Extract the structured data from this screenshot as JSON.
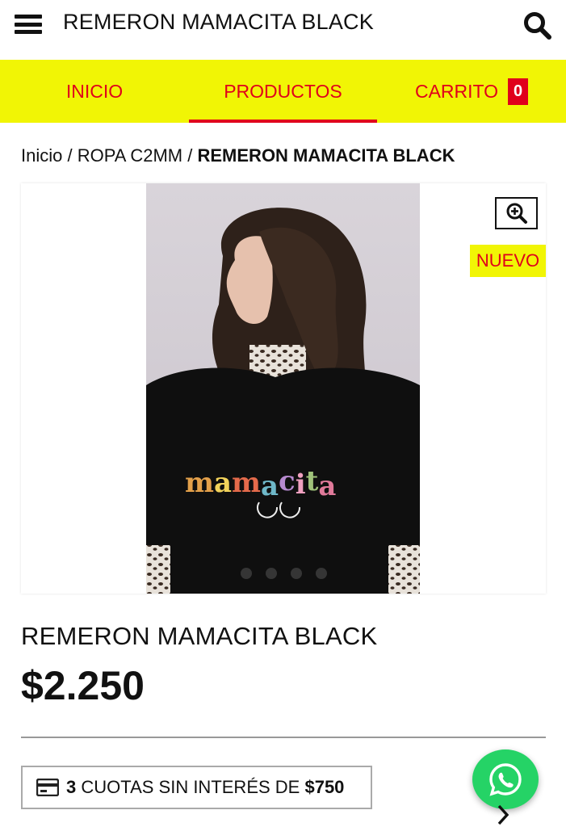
{
  "header": {
    "menu_icon": "hamburger-menu-icon",
    "title": "REMERON MAMACITA BLACK",
    "search_icon": "search-icon"
  },
  "nav": {
    "items": [
      {
        "label": "INICIO",
        "active": false
      },
      {
        "label": "PRODUCTOS",
        "active": true
      },
      {
        "label": "CARRITO",
        "active": false
      }
    ],
    "cart_count": "0"
  },
  "breadcrumb": {
    "home": "Inicio",
    "sep1": "/",
    "category": "ROPA C2MM",
    "sep2": "/",
    "current": "REMERON MAMACITA BLACK"
  },
  "gallery": {
    "zoom_icon": "zoom-in-icon",
    "badge": "NUEVO",
    "shirt_text": "mamacita",
    "slide_count": 4,
    "active_slide": 1
  },
  "product": {
    "name": "REMERON MAMACITA BLACK",
    "price": "$2.250"
  },
  "installments": {
    "icon": "credit-card-icon",
    "count": "3",
    "text": "CUOTAS SIN INTERÉS DE",
    "amount": "$750"
  },
  "floating": {
    "whatsapp_icon": "whatsapp-icon",
    "next_icon": "chevron-right-icon"
  },
  "colors": {
    "accent_yellow": "#f1f505",
    "accent_red": "#e0001b",
    "whatsapp_green": "#25d366"
  }
}
